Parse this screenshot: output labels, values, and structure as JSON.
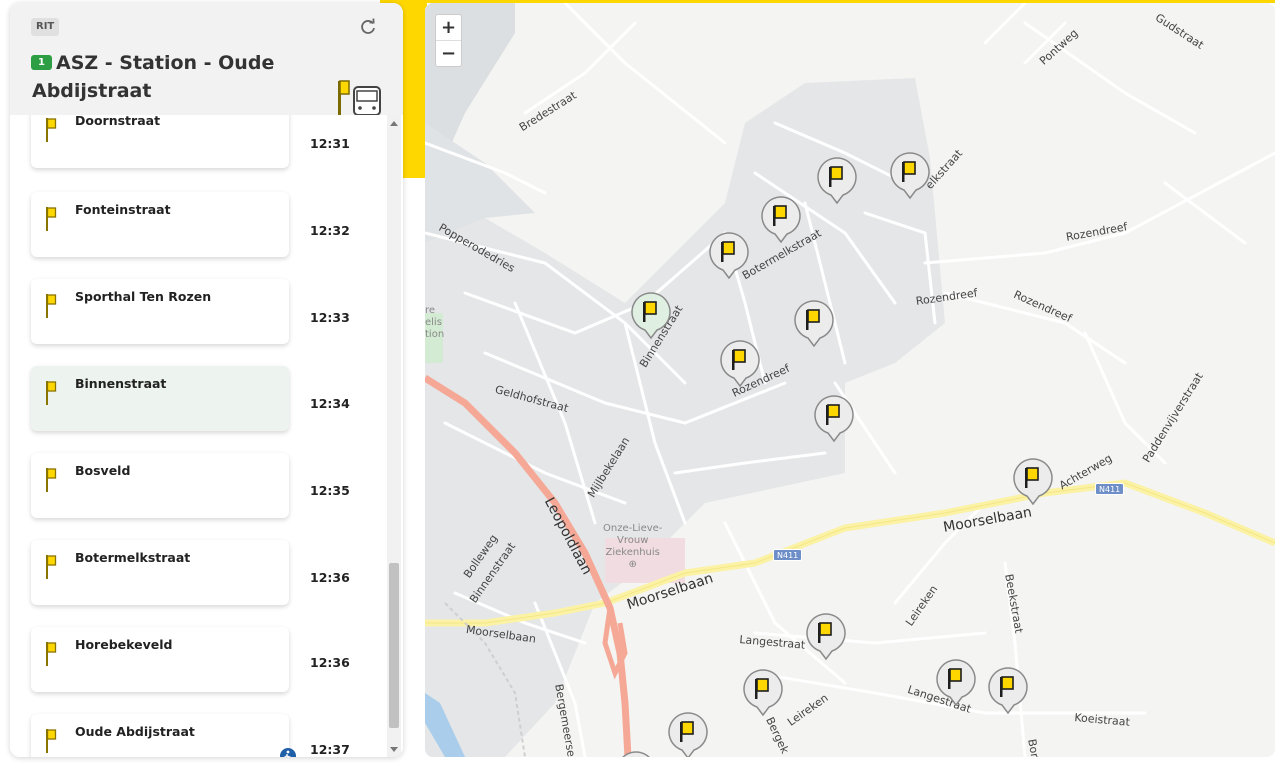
{
  "panel": {
    "rit_badge": "RIT",
    "line_number": "1",
    "route_title": "ASZ - Station - Oude Abdijstraat"
  },
  "stops": [
    {
      "name": "Doornstraat",
      "time": "12:31",
      "current": false,
      "wheelchair": false
    },
    {
      "name": "Fonteinstraat",
      "time": "12:32",
      "current": false,
      "wheelchair": false
    },
    {
      "name": "Sporthal Ten Rozen",
      "time": "12:33",
      "current": false,
      "wheelchair": false
    },
    {
      "name": "Binnenstraat",
      "time": "12:34",
      "current": true,
      "wheelchair": false
    },
    {
      "name": "Bosveld",
      "time": "12:35",
      "current": false,
      "wheelchair": false
    },
    {
      "name": "Botermelkstraat",
      "time": "12:36",
      "current": false,
      "wheelchair": false
    },
    {
      "name": "Horebekeveld",
      "time": "12:36",
      "current": false,
      "wheelchair": false
    },
    {
      "name": "Oude Abdijstraat",
      "time": "12:37",
      "current": false,
      "wheelchair": true
    }
  ],
  "map": {
    "zoom_in": "+",
    "zoom_out": "−",
    "hospital": [
      "Onze-Lieve-",
      "Vrouw",
      "Ziekenhuis"
    ],
    "shield_a": "N411",
    "shield_b": "N411",
    "partial_label": [
      "re",
      "elis",
      "tion"
    ],
    "labels": {
      "gudstraat": "Gudstraat",
      "pontweg": "Pontweg",
      "bredestraat": "Bredestraat",
      "melkstraat": "elkstraat",
      "popperodedries": "Popperodedries",
      "rozendreef1": "Rozendreef",
      "rozendreef2": "Rozendreef",
      "rozendreef3": "Rozendreef",
      "rozendreef4": "Rozendreef",
      "botermelkstraat": "Botermelkstraat",
      "binnenstraat1": "Binnenstraat",
      "geldhofstraat": "Geldhofstraat",
      "mijlbekelaan": "Mijlbekelaan",
      "leopoldlaan": "Leopoldlaan",
      "paddenvijverstraat": "Paddenvijverstraat",
      "achterweg": "Achterweg",
      "moorselbaan1": "Moorselbaan",
      "moorselbaan2": "Moorselbaan",
      "moorselbaan3": "Moorselbaan",
      "bolleweg": "Bolleweg",
      "binnenstraat2": "Binnenstraat",
      "langestraat1": "Langestraat",
      "langestraat2": "Langestraat",
      "leireken1": "Leireken",
      "leireken2": "Leireken",
      "beekstraat": "Beekstraat",
      "koeistraat": "Koeistraat",
      "bergemeersen": "Bergemeersen",
      "bergek": "Bergek",
      "borr": "Borr"
    }
  },
  "colors": {
    "accent_yellow": "#ffd700",
    "line_green": "#2e9e44",
    "current_stop_bg": "#edf4ef",
    "stop_pole": "#c8a900",
    "main_road": "#f5a896",
    "secondary_road": "#fbf2a6",
    "built_area": "#e4e6e8"
  }
}
